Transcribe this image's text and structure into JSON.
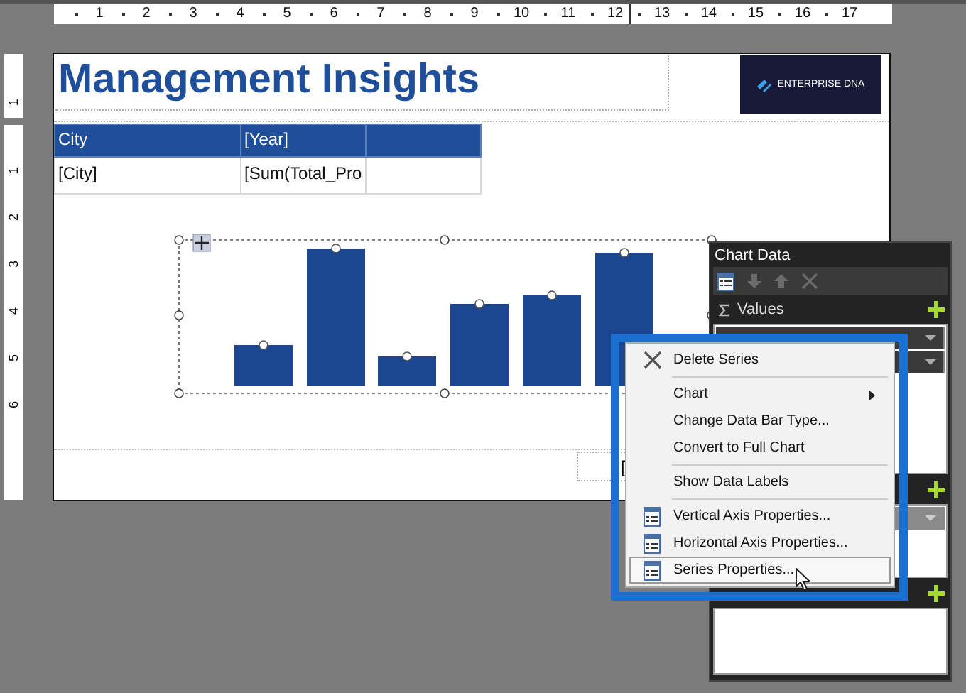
{
  "ruler_top": {
    "labels": [
      "1",
      "2",
      "3",
      "4",
      "5",
      "6",
      "7",
      "8",
      "9",
      "10",
      "11",
      "12",
      "13",
      "14",
      "15",
      "16",
      "17"
    ]
  },
  "ruler_left": {
    "labels": [
      "1",
      "1",
      "2",
      "3",
      "4",
      "5",
      "6"
    ]
  },
  "report": {
    "title": "Management Insights",
    "logo": {
      "text": "ENTERPRISE DNA"
    },
    "table": {
      "columns": [
        "City",
        "[Year]"
      ],
      "rows": [
        [
          "[City]",
          "[Sum(Total_Pro"
        ]
      ]
    },
    "footer_field": "["
  },
  "chart_data_panel": {
    "title": "Chart Data",
    "sections": [
      {
        "label": "Values"
      }
    ]
  },
  "context_menu": {
    "items": [
      {
        "kind": "delete",
        "label": "Delete Series",
        "selected": false
      },
      {
        "kind": "separator"
      },
      {
        "kind": "submenu",
        "label": "Chart",
        "selected": false
      },
      {
        "kind": "plain",
        "label": "Change Data Bar Type...",
        "selected": false
      },
      {
        "kind": "plain",
        "label": "Convert to Full Chart",
        "selected": false
      },
      {
        "kind": "separator"
      },
      {
        "kind": "plain",
        "label": "Show Data Labels",
        "selected": false
      },
      {
        "kind": "separator"
      },
      {
        "kind": "properties",
        "label": "Vertical Axis Properties...",
        "selected": false
      },
      {
        "kind": "properties",
        "label": "Horizontal Axis Properties...",
        "selected": false
      },
      {
        "kind": "properties",
        "label": "Series Properties...",
        "selected": true
      }
    ]
  }
}
